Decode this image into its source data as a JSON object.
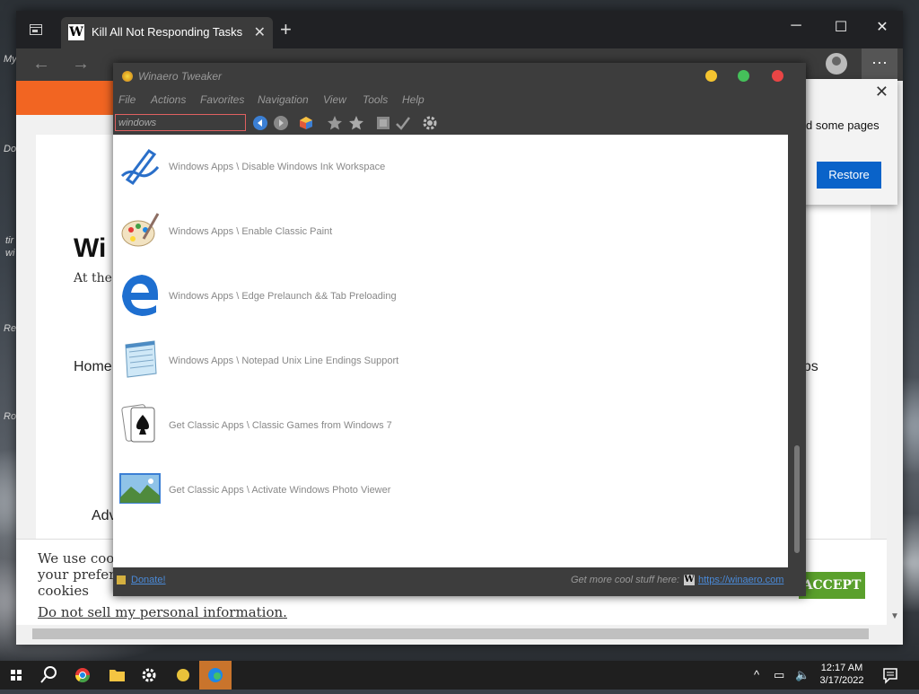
{
  "desktop": {
    "texts": [
      "My",
      "Do",
      "tir",
      "wi",
      "Re",
      "Ro"
    ]
  },
  "browser": {
    "tab": {
      "title": "Kill All Not Responding Tasks in Windows",
      "favicon": "W"
    },
    "new_tab": "+",
    "more_label": "···"
  },
  "page": {
    "heading": "Wi",
    "subtitle": "At the e",
    "nav_home": "Home",
    "nav_apps": "pps",
    "advert": "Adv",
    "cookie_text": "We use cook your prefer the cookies",
    "cookie_link": "Do not sell my personal information",
    "cookie_link_suffix": ".",
    "cookie_accept": "ACCEPT"
  },
  "restore_popup": {
    "text": "d some pages",
    "button": "Restore"
  },
  "tweaker": {
    "title": "Winaero Tweaker",
    "menu": [
      "File",
      "Actions",
      "Favorites",
      "Navigation",
      "View",
      "Tools",
      "Help"
    ],
    "search_value": "windows",
    "items": [
      {
        "label": "Windows Apps \\ Disable Windows Ink Workspace",
        "icon": "ink-pen-icon"
      },
      {
        "label": "Windows Apps \\ Enable Classic Paint",
        "icon": "paint-palette-icon"
      },
      {
        "label": "Windows Apps \\ Edge Prelaunch && Tab Preloading",
        "icon": "edge-logo-icon"
      },
      {
        "label": "Windows Apps \\ Notepad Unix Line Endings Support",
        "icon": "notepad-icon"
      },
      {
        "label": "Get Classic Apps \\ Classic Games from Windows 7",
        "icon": "playing-card-icon"
      },
      {
        "label": "Get Classic Apps \\ Activate Windows Photo Viewer",
        "icon": "photo-viewer-icon"
      }
    ],
    "status": {
      "donate": "Donate!",
      "more_text": "Get more cool stuff here:",
      "url": "https://winaero.com"
    }
  },
  "taskbar": {
    "time": "12:17 AM",
    "date": "3/17/2022"
  }
}
